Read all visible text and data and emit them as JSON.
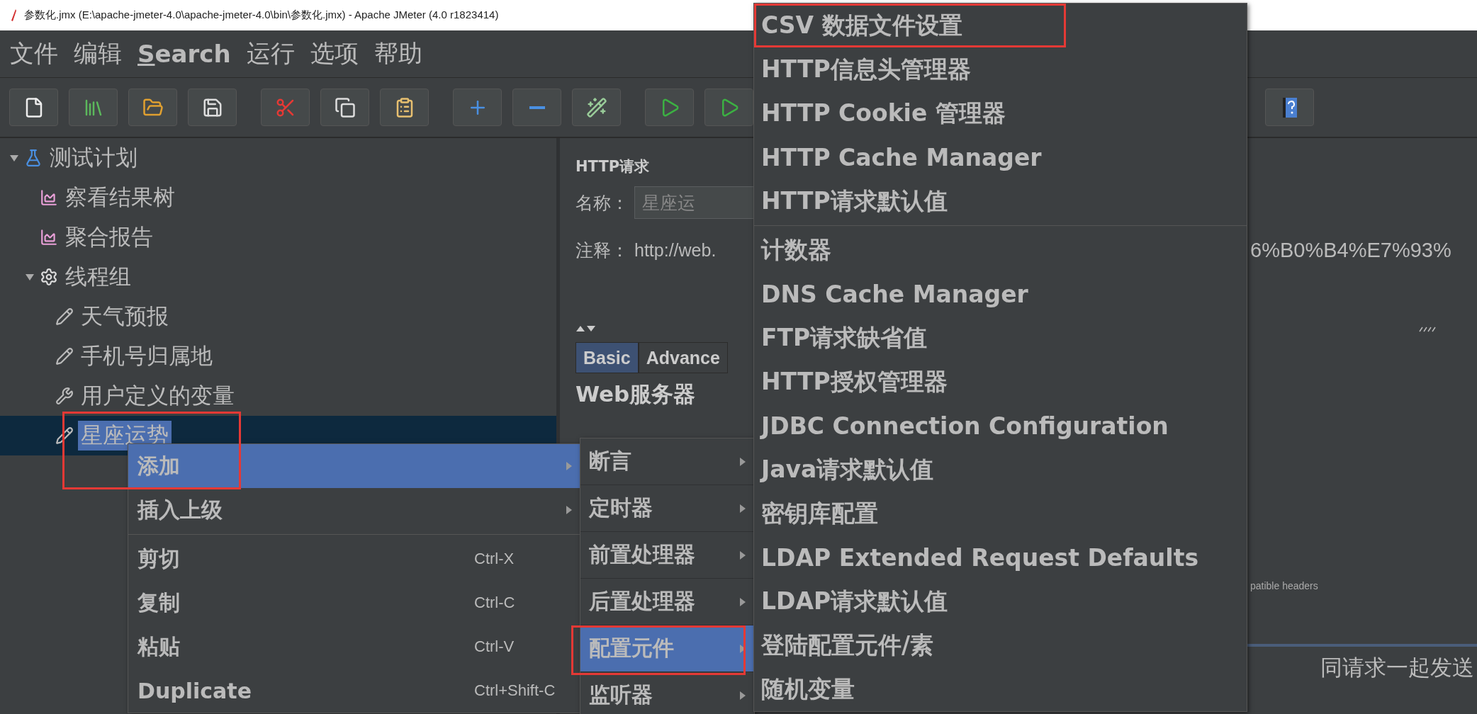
{
  "window": {
    "title": "参数化.jmx (E:\\apache-jmeter-4.0\\apache-jmeter-4.0\\bin\\参数化.jmx) - Apache JMeter (4.0 r1823414)"
  },
  "menu_bar": [
    {
      "label": "文件",
      "mnemonic": false
    },
    {
      "label": "编辑",
      "mnemonic": false
    },
    {
      "label": "Search",
      "mnemonic": true
    },
    {
      "label": "运行",
      "mnemonic": false
    },
    {
      "label": "选项",
      "mnemonic": false
    },
    {
      "label": "帮助",
      "mnemonic": false
    }
  ],
  "tree": [
    {
      "label": "测试计划",
      "kind": "plan",
      "expanded": true,
      "selected": false,
      "children": [
        {
          "label": "察看结果树",
          "kind": "listener",
          "selected": false
        },
        {
          "label": "聚合报告",
          "kind": "listener",
          "selected": false
        },
        {
          "label": "线程组",
          "kind": "thread_group",
          "expanded": true,
          "selected": false,
          "children": [
            {
              "label": "天气预报",
              "kind": "sampler",
              "selected": false
            },
            {
              "label": "手机号归属地",
              "kind": "sampler",
              "selected": false
            },
            {
              "label": "用户定义的变量",
              "kind": "config",
              "selected": false
            },
            {
              "label": "星座运势",
              "kind": "sampler",
              "selected": true
            }
          ]
        }
      ]
    }
  ],
  "request_panel": {
    "title": "HTTP请求",
    "name_label": "名称：",
    "name_value": "星座运",
    "comment_label": "注释：",
    "comment_value": "http://web.",
    "comment_value_tail": "6%B0%B4%E7%93%",
    "tabs": [
      {
        "label": "Basic",
        "selected": true
      },
      {
        "label": "Advance",
        "selected": false
      }
    ],
    "section_title": "Web服务器",
    "option_text": "patible headers",
    "footer_text": "同请求一起发送"
  },
  "context_menu": [
    {
      "kind": "submenu",
      "label": "添加",
      "selected": true,
      "boxed": true
    },
    {
      "kind": "submenu",
      "label": "插入上级",
      "selected": false,
      "boxed": false
    },
    {
      "kind": "separator"
    },
    {
      "kind": "command",
      "label": "剪切",
      "shortcut": "Ctrl-X",
      "selected": false,
      "boxed": false
    },
    {
      "kind": "command",
      "label": "复制",
      "shortcut": "Ctrl-C",
      "selected": false,
      "boxed": false
    },
    {
      "kind": "command",
      "label": "粘贴",
      "shortcut": "Ctrl-V",
      "selected": false,
      "boxed": false
    },
    {
      "kind": "command",
      "label": "Duplicate",
      "shortcut": "Ctrl+Shift-C",
      "selected": false,
      "boxed": false
    }
  ],
  "add_submenu": [
    {
      "kind": "submenu",
      "label": "断言",
      "selected": false,
      "boxed": false
    },
    {
      "kind": "submenu",
      "label": "定时器",
      "selected": false,
      "boxed": false
    },
    {
      "kind": "submenu",
      "label": "前置处理器",
      "selected": false,
      "boxed": false
    },
    {
      "kind": "submenu",
      "label": "后置处理器",
      "selected": false,
      "boxed": false
    },
    {
      "kind": "submenu",
      "label": "配置元件",
      "selected": true,
      "boxed": true
    },
    {
      "kind": "submenu",
      "label": "监听器",
      "selected": false,
      "boxed": false
    }
  ],
  "config_submenu": [
    {
      "kind": "command",
      "label": "CSV 数据文件设置",
      "selected": false,
      "boxed": true
    },
    {
      "kind": "command",
      "label": "HTTP信息头管理器",
      "selected": false,
      "boxed": false
    },
    {
      "kind": "command",
      "label": "HTTP Cookie 管理器",
      "selected": false,
      "boxed": false
    },
    {
      "kind": "command",
      "label": "HTTP Cache Manager",
      "selected": false,
      "boxed": false
    },
    {
      "kind": "command",
      "label": "HTTP请求默认值",
      "selected": false,
      "boxed": false
    },
    {
      "kind": "separator"
    },
    {
      "kind": "command",
      "label": "计数器",
      "selected": false,
      "boxed": false
    },
    {
      "kind": "command",
      "label": "DNS Cache Manager",
      "selected": false,
      "boxed": false
    },
    {
      "kind": "command",
      "label": "FTP请求缺省值",
      "selected": false,
      "boxed": false
    },
    {
      "kind": "command",
      "label": "HTTP授权管理器",
      "selected": false,
      "boxed": false
    },
    {
      "kind": "command",
      "label": "JDBC Connection Configuration",
      "selected": false,
      "boxed": false
    },
    {
      "kind": "command",
      "label": "Java请求默认值",
      "selected": false,
      "boxed": false
    },
    {
      "kind": "command",
      "label": "密钥库配置",
      "selected": false,
      "boxed": false
    },
    {
      "kind": "command",
      "label": "LDAP Extended Request Defaults",
      "selected": false,
      "boxed": false
    },
    {
      "kind": "command",
      "label": "LDAP请求默认值",
      "selected": false,
      "boxed": false
    },
    {
      "kind": "command",
      "label": "登陆配置元件/素",
      "selected": false,
      "boxed": false
    },
    {
      "kind": "command",
      "label": "随机变量",
      "selected": false,
      "boxed": false
    }
  ]
}
